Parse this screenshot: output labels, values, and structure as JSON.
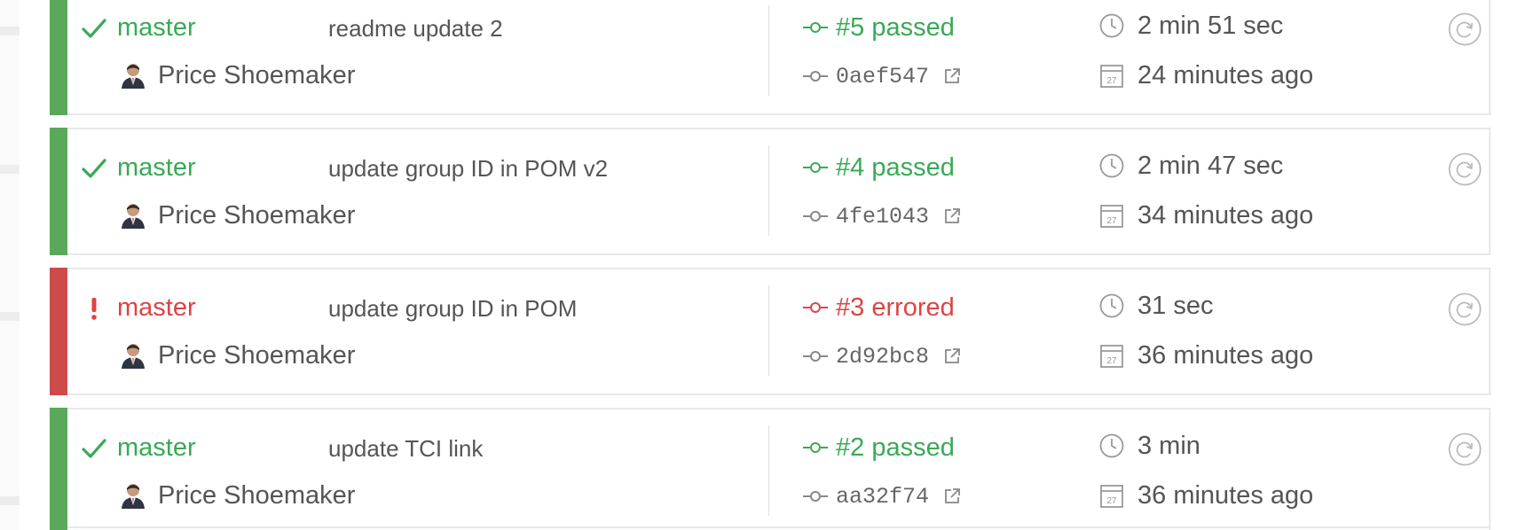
{
  "builds": [
    {
      "state": "passed",
      "branch": "master",
      "message": "readme update 2",
      "author": "Price Shoemaker",
      "build_label": "#5 passed",
      "commit": "0aef547",
      "duration": "2 min 51 sec",
      "finished": "24 minutes ago"
    },
    {
      "state": "passed",
      "branch": "master",
      "message": "update group ID in POM v2",
      "author": "Price Shoemaker",
      "build_label": "#4 passed",
      "commit": "4fe1043",
      "duration": "2 min 47 sec",
      "finished": "34 minutes ago"
    },
    {
      "state": "errored",
      "branch": "master",
      "message": "update group ID in POM",
      "author": "Price Shoemaker",
      "build_label": "#3 errored",
      "commit": "2d92bc8",
      "duration": "31 sec",
      "finished": "36 minutes ago"
    },
    {
      "state": "passed",
      "branch": "master",
      "message": "update TCI link",
      "author": "Price Shoemaker",
      "build_label": "#2 passed",
      "commit": "aa32f74",
      "duration": "3 min",
      "finished": "36 minutes ago"
    }
  ],
  "icons": {
    "passed": "check-icon",
    "errored": "exclamation-icon",
    "commit": "commit-icon",
    "external": "external-link-icon",
    "duration": "clock-icon",
    "finished": "calendar-icon",
    "restart": "restart-icon"
  },
  "calendar_icon_text": "27",
  "colors": {
    "passed": "#39aa56",
    "errored": "#db4545",
    "passed_bar": "#5aa95b",
    "errored_bar": "#cc4c4a"
  }
}
